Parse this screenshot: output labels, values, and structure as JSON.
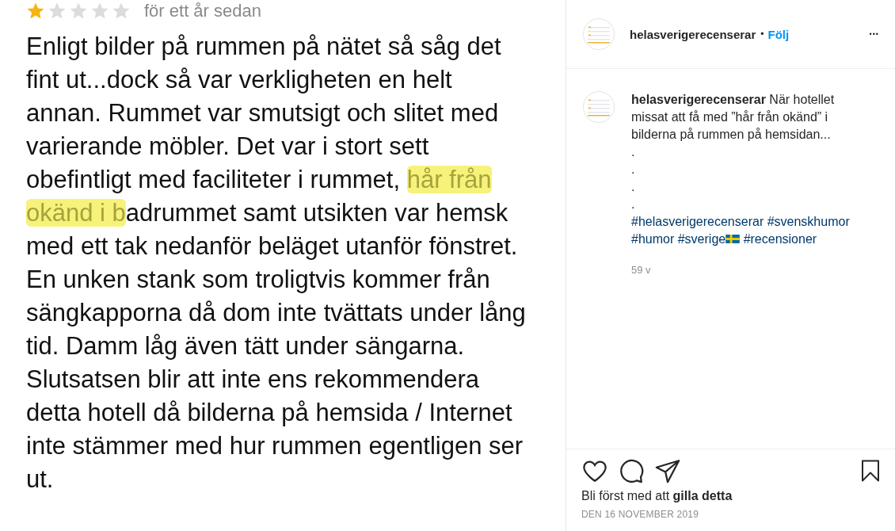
{
  "review": {
    "stars": 1,
    "time": "för ett år sedan",
    "lines": [
      [
        {
          "text": "Enligt bilder på rummen på nätet så såg det",
          "highlighted": false
        }
      ],
      [
        {
          "text": "fint ut...dock så var verkligheten en helt",
          "highlighted": false
        }
      ],
      [
        {
          "text": "annan. Rummet var smutsigt och slitet med",
          "highlighted": false
        }
      ],
      [
        {
          "text": "varierande möbler. Det var i stort sett",
          "highlighted": false
        }
      ],
      [
        {
          "text": "obefintligt med faciliteter i rummet, ",
          "highlighted": false
        },
        {
          "text": "hår från",
          "highlighted": true
        }
      ],
      [
        {
          "text": "okänd i b",
          "highlighted": true
        },
        {
          "text": "adrummet samt utsikten var hemsk",
          "highlighted": false
        }
      ],
      [
        {
          "text": "med ett tak nedanför beläget utanför fönstret.",
          "highlighted": false
        }
      ],
      [
        {
          "text": "En unken stank som troligtvis kommer från",
          "highlighted": false
        }
      ],
      [
        {
          "text": "sängkapporna då dom inte tvättats under lång",
          "highlighted": false
        }
      ],
      [
        {
          "text": "tid. Damm låg även tätt under sängarna.",
          "highlighted": false
        }
      ],
      [
        {
          "text": "Slutsatsen blir att inte ens rekommendera",
          "highlighted": false
        }
      ],
      [
        {
          "text": "detta hotell då bilderna på hemsida / Internet",
          "highlighted": false
        }
      ],
      [
        {
          "text": "inte stämmer med hur rummen egentligen ser",
          "highlighted": false
        }
      ],
      [
        {
          "text": "ut.",
          "highlighted": false
        }
      ]
    ]
  },
  "post": {
    "username": "helasverigerecenserar",
    "separator": "•",
    "follow": "Följ",
    "more": "•••",
    "caption": {
      "username": "helasverigerecenserar",
      "text": "När hotellet missat att få med ”hår från okänd” i bilderna på rummen på hemsidan...",
      "dots": [
        ".",
        ".",
        ".",
        "."
      ],
      "hashtags": [
        {
          "text": "#helasverigerecenserar",
          "flag": false
        },
        {
          "text": "#svenskhumor",
          "flag": false
        },
        {
          "text": "#humor",
          "flag": false
        },
        {
          "text": "#sverige",
          "flag": true
        },
        {
          "text": "#recensioner",
          "flag": false
        }
      ],
      "age": "59 v"
    },
    "likes_prefix": "Bli först med att",
    "likes_link": "gilla detta",
    "date": "DEN 16 NOVEMBER 2019"
  }
}
